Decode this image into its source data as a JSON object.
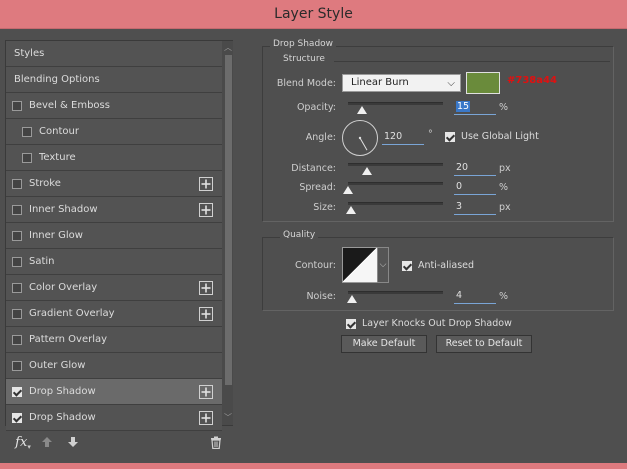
{
  "window": {
    "title": "Layer Style"
  },
  "left_list": [
    {
      "label": "Styles",
      "checkbox": false,
      "checked": false,
      "plus": false,
      "indent": 0,
      "selected": false
    },
    {
      "label": "Blending Options",
      "checkbox": false,
      "checked": false,
      "plus": false,
      "indent": 0,
      "selected": false
    },
    {
      "label": "Bevel & Emboss",
      "checkbox": true,
      "checked": false,
      "plus": false,
      "indent": 0,
      "selected": false
    },
    {
      "label": "Contour",
      "checkbox": true,
      "checked": false,
      "plus": false,
      "indent": 1,
      "selected": false
    },
    {
      "label": "Texture",
      "checkbox": true,
      "checked": false,
      "plus": false,
      "indent": 1,
      "selected": false
    },
    {
      "label": "Stroke",
      "checkbox": true,
      "checked": false,
      "plus": true,
      "indent": 0,
      "selected": false
    },
    {
      "label": "Inner Shadow",
      "checkbox": true,
      "checked": false,
      "plus": true,
      "indent": 0,
      "selected": false
    },
    {
      "label": "Inner Glow",
      "checkbox": true,
      "checked": false,
      "plus": false,
      "indent": 0,
      "selected": false
    },
    {
      "label": "Satin",
      "checkbox": true,
      "checked": false,
      "plus": false,
      "indent": 0,
      "selected": false
    },
    {
      "label": "Color Overlay",
      "checkbox": true,
      "checked": false,
      "plus": true,
      "indent": 0,
      "selected": false
    },
    {
      "label": "Gradient Overlay",
      "checkbox": true,
      "checked": false,
      "plus": true,
      "indent": 0,
      "selected": false
    },
    {
      "label": "Pattern Overlay",
      "checkbox": true,
      "checked": false,
      "plus": false,
      "indent": 0,
      "selected": false
    },
    {
      "label": "Outer Glow",
      "checkbox": true,
      "checked": false,
      "plus": false,
      "indent": 0,
      "selected": false
    },
    {
      "label": "Drop Shadow",
      "checkbox": true,
      "checked": true,
      "plus": true,
      "indent": 0,
      "selected": true
    },
    {
      "label": "Drop Shadow",
      "checkbox": true,
      "checked": true,
      "plus": true,
      "indent": 0,
      "selected": false
    }
  ],
  "bottom_tools": {
    "fx_label": "fx",
    "icons": [
      "fx-icon",
      "move-up-icon",
      "move-down-icon",
      "trash-icon"
    ]
  },
  "drop_shadow": {
    "group_title": "Drop Shadow",
    "structure_title": "Structure",
    "blend_mode_label": "Blend Mode:",
    "blend_mode_value": "Linear Burn",
    "color_hex": "#6a8b3b",
    "color_annotation": "#738a44",
    "opacity_label": "Opacity:",
    "opacity_value": "15",
    "opacity_unit": "%",
    "opacity_fraction": 0.15,
    "angle_label": "Angle:",
    "angle_value": "120",
    "angle_unit": "°",
    "angle_degrees": 120,
    "use_global_light_label": "Use Global Light",
    "use_global_light": true,
    "distance_label": "Distance:",
    "distance_value": "20",
    "distance_unit": "px",
    "distance_fraction": 0.2,
    "spread_label": "Spread:",
    "spread_value": "0",
    "spread_unit": "%",
    "spread_fraction": 0.0,
    "size_label": "Size:",
    "size_value": "3",
    "size_unit": "px",
    "size_fraction": 0.03
  },
  "quality": {
    "title": "Quality",
    "contour_label": "Contour:",
    "anti_aliased_label": "Anti-aliased",
    "anti_aliased": true,
    "noise_label": "Noise:",
    "noise_value": "4",
    "noise_unit": "%",
    "noise_fraction": 0.04
  },
  "layer_knocks_out_label": "Layer Knocks Out Drop Shadow",
  "layer_knocks_out": true,
  "buttons": {
    "make_default": "Make Default",
    "reset_to_default": "Reset to Default"
  }
}
